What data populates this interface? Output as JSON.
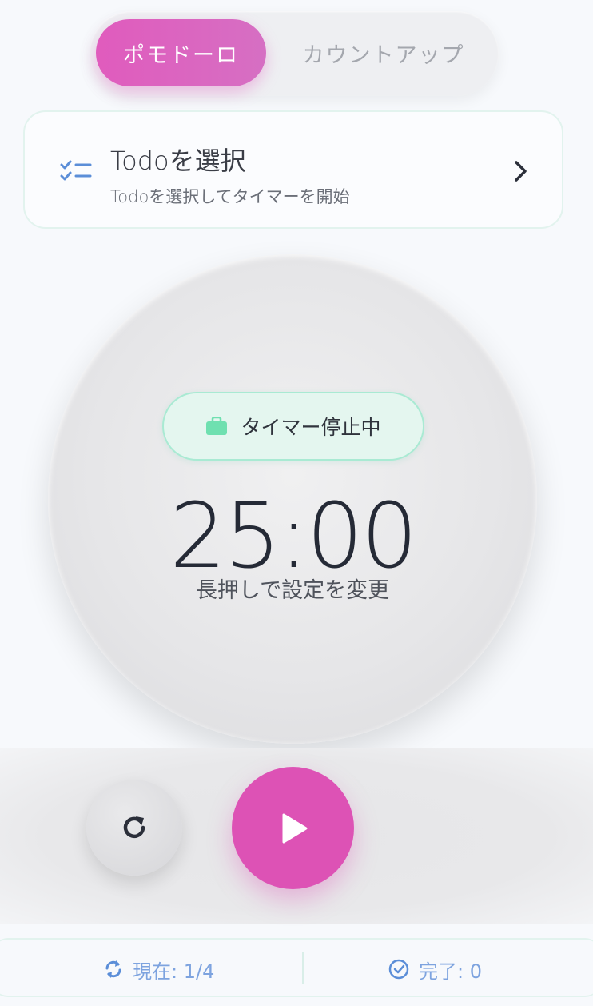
{
  "mode_toggle": {
    "active_label": "ポモドーロ",
    "inactive_label": "カウントアップ"
  },
  "todo": {
    "title": "Todoを選択",
    "subtitle": "Todoを選択してタイマーを開始"
  },
  "timer": {
    "status": "タイマー停止中",
    "time": "25:00",
    "hint": "長押しで設定を変更"
  },
  "controls": {
    "reset_icon": "reset-icon",
    "play_icon": "play-icon"
  },
  "stats": {
    "current": "現在: 1/4",
    "completed": "完了: 0"
  },
  "colors": {
    "accent": "#dd52b5",
    "status_green": "#6fe0b0",
    "stat_blue": "#7da3df"
  }
}
